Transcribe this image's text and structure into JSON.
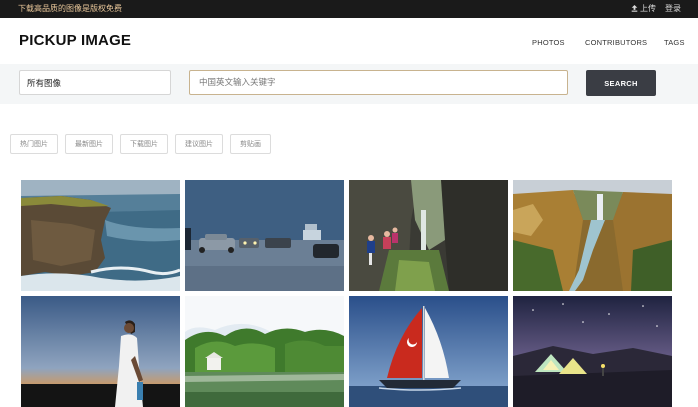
{
  "topbar": {
    "promo_text": "下载高品质的图像是版权免费",
    "upload_label": "上传",
    "login_label": "登录"
  },
  "header": {
    "logo": "PICKUP IMAGE",
    "nav": [
      "PHOTOS",
      "CONTRIBUTORS",
      "TAGS"
    ]
  },
  "search": {
    "scope_value": "所有图像",
    "placeholder": "中国英文输入关键字",
    "button_label": "SEARCH"
  },
  "filters": [
    "热门图片",
    "最新图片",
    "下载图片",
    "建议图片",
    "剪贴画"
  ],
  "gallery": {
    "photos": [
      {
        "subject": "coastal-cliffs"
      },
      {
        "subject": "parking-lot-dusk"
      },
      {
        "subject": "gorge-hikers"
      },
      {
        "subject": "canyon-waterfall"
      },
      {
        "subject": "woman-white-dress"
      },
      {
        "subject": "lake-pavilion"
      },
      {
        "subject": "red-sailboat"
      },
      {
        "subject": "tent-night-sky"
      }
    ]
  },
  "colors": {
    "topbar_bg": "#1a1a1a",
    "promo_text": "#e9c79a",
    "search_band_bg": "#f4f6f7",
    "search_button_bg": "#3a3d44",
    "query_border": "#c8b38f"
  }
}
